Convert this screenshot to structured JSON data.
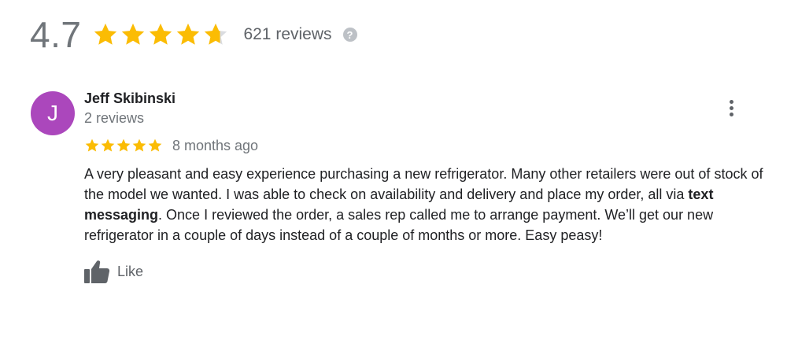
{
  "summary": {
    "rating": "4.7",
    "rating_value": 4.7,
    "stars_max": 5,
    "review_count_text": "621 reviews",
    "help_icon": "question-circle-icon",
    "star_color": "#fbbc04",
    "empty_star_color": "#dadce0"
  },
  "review": {
    "avatar_letter": "J",
    "avatar_color": "#ab47bc",
    "reviewer_name": "Jeff Skibinski",
    "reviewer_meta": "2 reviews",
    "more_icon": "more-vert-icon",
    "stars": 5,
    "date": "8 months ago",
    "text_parts": {
      "part1": "A very pleasant and easy experience purchasing a new refrigerator. Many other retailers were out of stock of the model we wanted. I was able to check on availability and delivery and place my order, all via ",
      "highlight": "text messaging",
      "part2": ". Once I reviewed the order, a sales rep called me to arrange payment. We’ll get our new refrigerator in a couple of days instead of a couple of months or more. Easy peasy!"
    },
    "like_icon": "thumbs-up-icon",
    "like_label": "Like"
  }
}
